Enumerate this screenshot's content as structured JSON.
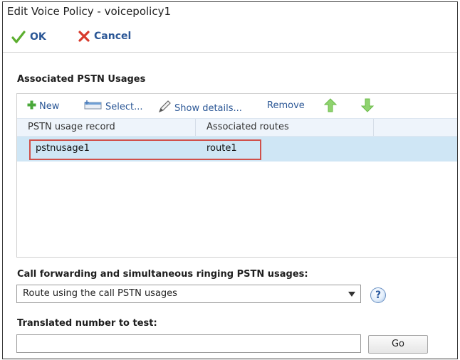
{
  "window": {
    "title": "Edit Voice Policy - voicepolicy1"
  },
  "toolbar": {
    "ok_label": "OK",
    "cancel_label": "Cancel",
    "ok_icon": "checkmark-icon",
    "cancel_icon": "x-icon"
  },
  "pstn_section": {
    "label": "Associated PSTN Usages",
    "actions": {
      "new_label": "New",
      "select_label": "Select...",
      "show_details_label": "Show details...",
      "remove_label": "Remove"
    },
    "columns": [
      "PSTN usage record",
      "Associated routes"
    ],
    "rows": [
      {
        "usage": "pstnusage1",
        "routes": "route1"
      }
    ],
    "colors": {
      "selected_row": "#cfe6f5",
      "highlight_border": "#d0504a"
    }
  },
  "call_forwarding": {
    "label": "Call forwarding and simultaneous ringing PSTN usages:",
    "selected_value": "Route using the call PSTN usages"
  },
  "translated_number": {
    "label": "Translated number to test:",
    "value": "",
    "go_label": "Go"
  }
}
